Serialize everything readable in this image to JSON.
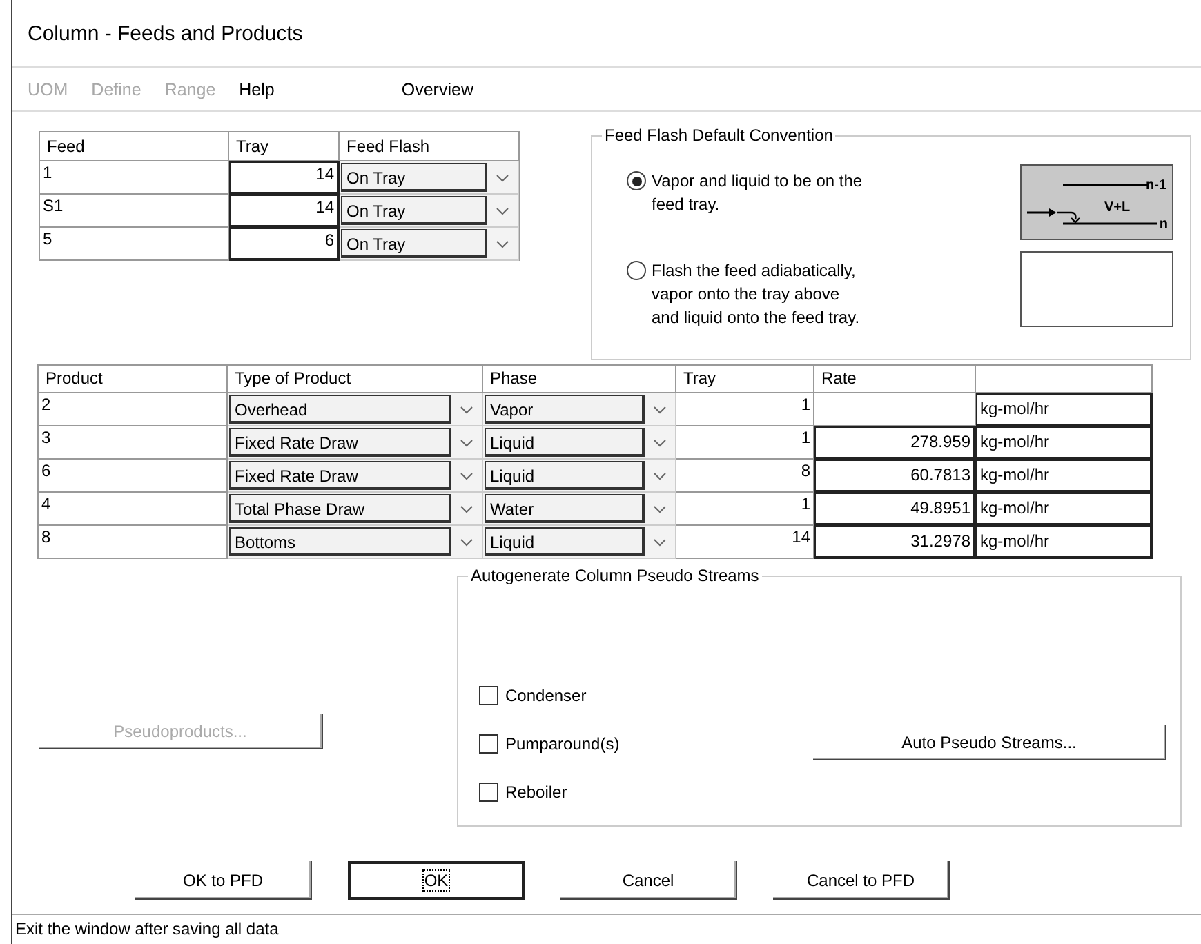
{
  "window": {
    "title": "Column - Feeds and Products"
  },
  "menu": [
    {
      "label": "UOM",
      "disabled": true
    },
    {
      "label": "Define",
      "disabled": true
    },
    {
      "label": "Range",
      "disabled": true
    },
    {
      "label": "Help",
      "disabled": false
    }
  ],
  "overview_button": {
    "label": "Overview"
  },
  "feeds": {
    "columns": [
      "Feed",
      "Tray",
      "Feed Flash"
    ],
    "rows": [
      {
        "feed": "1",
        "tray": "14",
        "feed_flash": "On Tray"
      },
      {
        "feed": "S1",
        "tray": "14",
        "feed_flash": "On Tray"
      },
      {
        "feed": "5",
        "tray": "6",
        "feed_flash": "On Tray"
      }
    ]
  },
  "feed_flash_convention": {
    "title": "Feed Flash Default Convention",
    "options": [
      {
        "lines": [
          "Vapor and liquid to be on the",
          "feed tray."
        ],
        "selected": true
      },
      {
        "lines": [
          "Flash the feed adiabatically,",
          "vapor onto the tray above",
          "and liquid onto the feed tray."
        ],
        "selected": false
      }
    ],
    "diagram_labels": {
      "upper_tray": "n-1",
      "feed": "V+L",
      "feed_tray": "n"
    }
  },
  "products": {
    "columns": [
      "Product",
      "Type of Product",
      "Phase",
      "Tray",
      "Rate"
    ],
    "rows": [
      {
        "product": "2",
        "type": "Overhead",
        "phase": "Vapor",
        "tray": "1",
        "unit": "kg-mol/hr"
      },
      {
        "product": "3",
        "type": "Fixed Rate Draw",
        "phase": "Liquid",
        "tray": "1",
        "rate": "278.959",
        "unit": "kg-mol/hr"
      },
      {
        "product": "6",
        "type": "Fixed Rate Draw",
        "phase": "Liquid",
        "tray": "8",
        "rate": "60.7813",
        "unit": "kg-mol/hr"
      },
      {
        "product": "4",
        "type": "Total Phase Draw",
        "phase": "Water",
        "tray": "1",
        "rate": "49.8951",
        "unit": "kg-mol/hr"
      },
      {
        "product": "8",
        "type": "Bottoms",
        "phase": "Liquid",
        "tray": "14",
        "rate": "31.2978",
        "unit": "kg-mol/hr"
      }
    ]
  },
  "pseudoproducts_button": {
    "label": "Pseudoproducts...",
    "disabled": true
  },
  "autogenerate": {
    "title": "Autogenerate Column Pseudo Streams",
    "checkboxes": [
      {
        "label": "Condenser",
        "checked": false
      },
      {
        "label": "Pumparound(s)",
        "checked": false
      },
      {
        "label": "Reboiler",
        "checked": false
      }
    ],
    "button": {
      "label": "Auto Pseudo Streams..."
    }
  },
  "buttons": [
    {
      "label": "OK to PFD",
      "focused": false
    },
    {
      "label": "OK",
      "focused": true
    },
    {
      "label": "Cancel",
      "focused": false
    },
    {
      "label": "Cancel to PFD",
      "focused": false
    }
  ],
  "status_bar": {
    "text": "Exit the window after saving all data"
  }
}
